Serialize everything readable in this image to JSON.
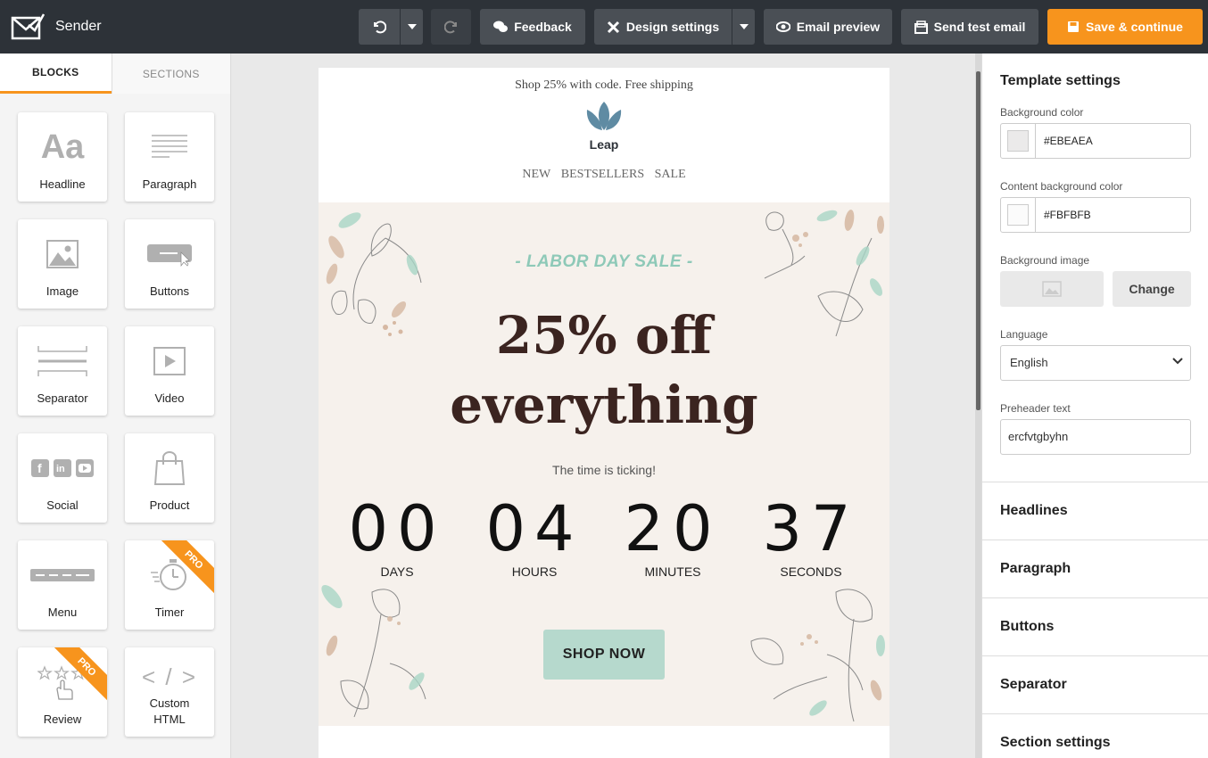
{
  "app": {
    "name": "Sender"
  },
  "toolbar": {
    "feedback_label": "Feedback",
    "design_settings_label": "Design settings",
    "email_preview_label": "Email preview",
    "send_test_label": "Send test email",
    "save_label": "Save & continue"
  },
  "colors": {
    "accent": "#f7941d",
    "topbar": "#2d3238",
    "shop_button": "#b6d9cd",
    "sale_label": "#8ec9b8"
  },
  "left_panel": {
    "tabs": [
      {
        "label": "BLOCKS",
        "active": true
      },
      {
        "label": "SECTIONS",
        "active": false
      }
    ],
    "blocks": [
      {
        "label": "Headline",
        "icon": "headline-icon"
      },
      {
        "label": "Paragraph",
        "icon": "paragraph-icon"
      },
      {
        "label": "Image",
        "icon": "image-icon"
      },
      {
        "label": "Buttons",
        "icon": "button-icon"
      },
      {
        "label": "Separator",
        "icon": "separator-icon"
      },
      {
        "label": "Video",
        "icon": "video-icon"
      },
      {
        "label": "Social",
        "icon": "social-icon"
      },
      {
        "label": "Product",
        "icon": "shopping-bag-icon"
      },
      {
        "label": "Menu",
        "icon": "menu-icon"
      },
      {
        "label": "Timer",
        "icon": "stopwatch-icon",
        "badge": "PRO"
      },
      {
        "label": "Review",
        "icon": "stars-icon",
        "badge": "PRO"
      },
      {
        "label": "Custom HTML",
        "icon": "code-icon"
      }
    ],
    "icon_text": {
      "headline": "Aa",
      "code": "< / >"
    }
  },
  "email": {
    "preheader": "Shop 25% with code. Free shipping",
    "brand": "Leap",
    "menu": [
      "NEW",
      "BESTSELLERS",
      "SALE"
    ],
    "sale_label": "- LABOR DAY SALE -",
    "headline_line1": "25% off",
    "headline_line2": "everything",
    "ticking_text": "The time is ticking!",
    "countdown": [
      {
        "value": "00",
        "unit": "DAYS"
      },
      {
        "value": "04",
        "unit": "HOURS"
      },
      {
        "value": "20",
        "unit": "MINUTES"
      },
      {
        "value": "37",
        "unit": "SECONDS"
      }
    ],
    "cta_label": "SHOP NOW"
  },
  "right_panel": {
    "title": "Template settings",
    "bg_color_label": "Background color",
    "bg_color_value": "#EBEAEA",
    "content_bg_label": "Content background color",
    "content_bg_value": "#FBFBFB",
    "bg_image_label": "Background image",
    "change_label": "Change",
    "language_label": "Language",
    "language_value": "English",
    "preheader_label": "Preheader text",
    "preheader_value": "ercfvtgbyhn",
    "sections": [
      "Headlines",
      "Paragraph",
      "Buttons",
      "Separator",
      "Section settings"
    ]
  }
}
